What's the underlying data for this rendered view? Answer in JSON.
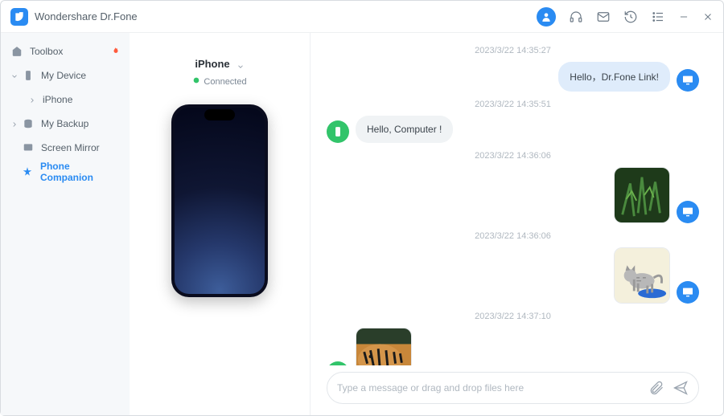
{
  "app": {
    "title": "Wondershare Dr.Fone"
  },
  "sidebar": {
    "toolbox": "Toolbox",
    "my_device": "My Device",
    "iphone": "iPhone",
    "my_backup": "My Backup",
    "screen_mirror": "Screen Mirror",
    "phone_companion": "Phone Companion"
  },
  "device": {
    "name": "iPhone",
    "status": "Connected"
  },
  "chat": {
    "ts1": "2023/3/22 14:35:27",
    "msg1": "Hello，Dr.Fone Link!",
    "ts2": "2023/3/22 14:35:51",
    "msg2": "Hello, Computer !",
    "ts3": "2023/3/22 14:36:06",
    "ts4": "2023/3/22 14:36:06",
    "ts5": "2023/3/22 14:37:10"
  },
  "composer": {
    "placeholder": "Type a message or drag and drop files here"
  }
}
